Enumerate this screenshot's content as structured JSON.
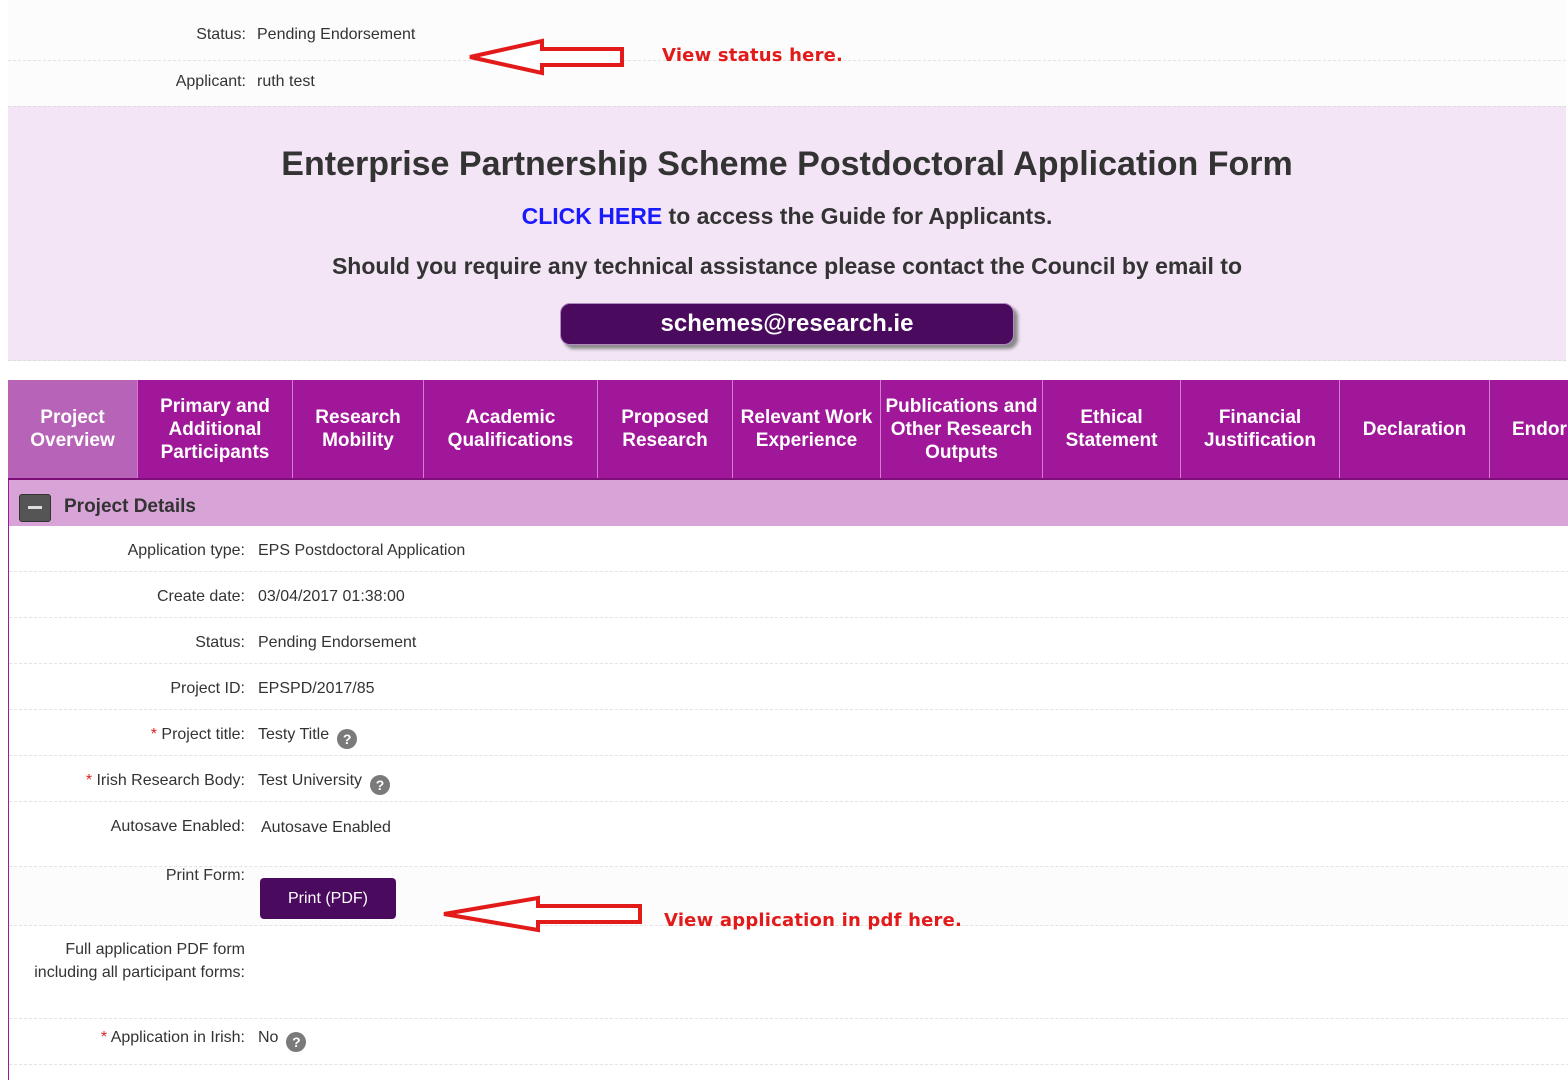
{
  "top": {
    "status_label": "Status:",
    "status_value": "Pending Endorsement",
    "applicant_label": "Applicant:",
    "applicant_value": "ruth test"
  },
  "annotations": {
    "status_note": "View status here.",
    "pdf_note": "View application in pdf here.",
    "color": "#e21a1a"
  },
  "banner": {
    "title": "Enterprise Partnership Scheme Postdoctoral Application Form",
    "guide_link": "CLICK HERE",
    "guide_text": " to access the Guide for Applicants.",
    "assist_text": "Should you require any technical assistance please contact the Council by email to",
    "email": "schemes@research.ie"
  },
  "tabs": [
    {
      "label": "Project Overview",
      "active": true
    },
    {
      "label": "Primary and Additional Participants"
    },
    {
      "label": "Research Mobility"
    },
    {
      "label": "Academic Qualifications"
    },
    {
      "label": "Proposed Research"
    },
    {
      "label": "Relevant Work Experience"
    },
    {
      "label": "Publications and Other Research Outputs"
    },
    {
      "label": "Ethical Statement"
    },
    {
      "label": "Financial Justification"
    },
    {
      "label": "Declaration"
    },
    {
      "label": "Endor"
    }
  ],
  "panel": {
    "title": "Project Details",
    "fields": [
      {
        "label": "Application type:",
        "value": "EPS Postdoctoral Application"
      },
      {
        "label": "Create date:",
        "value": "03/04/2017 01:38:00"
      },
      {
        "label": "Status:",
        "value": "Pending Endorsement"
      },
      {
        "label": "Project ID:",
        "value": "EPSPD/2017/85"
      },
      {
        "label": "Project title:",
        "value": "Testy Title",
        "required": true,
        "help": true
      },
      {
        "label": "Irish Research Body:",
        "value": "Test University",
        "required": true,
        "help": true
      },
      {
        "label": "Autosave Enabled:",
        "value": "Autosave Enabled"
      }
    ],
    "print_label": "Print Form:",
    "print_button": "Print (PDF)",
    "full_pdf_label": "Full application PDF form including all participant forms:",
    "irish_label": "Application in Irish:",
    "irish_value": "No"
  },
  "colors": {
    "tab_bar": "#a0179a",
    "active_tab": "#b663b8",
    "panel_header": "#d8a4d8",
    "banner_bg": "#f3e5f5",
    "button": "#4a0a5e"
  }
}
